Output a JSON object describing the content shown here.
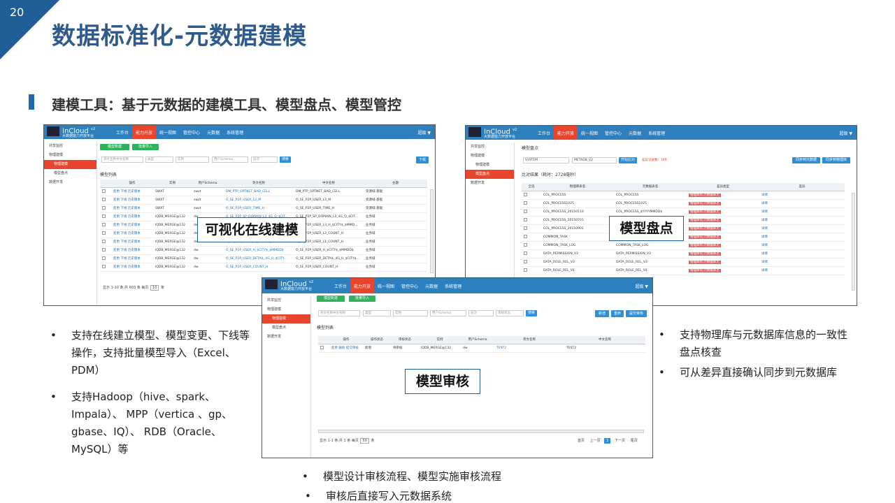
{
  "page_number": "20",
  "title": "数据标准化-元数据建模",
  "subtitle": "建模工具：基于元数据的建模工具、模型盘点、模型管控",
  "brand": {
    "name": "InCloud",
    "version": "v2",
    "tagline": "大数据能力开放平台",
    "accent": "#e8452c",
    "bar": "#2e7fbe"
  },
  "nav": [
    "工作台",
    "能力开放",
    "统一视图",
    "管控中心",
    "元数据",
    "系统管理"
  ],
  "nav_active": "能力开放",
  "user": "超级 ▼",
  "sidebar": [
    "共享监控",
    "物理建模",
    "物理建模",
    "模型盘点",
    "数据开发"
  ],
  "shot1": {
    "btn_new": "模型新建",
    "btn_import": "批量导入",
    "filters": [
      "英文名称中文名称",
      "类型",
      "实例",
      "用户Schema",
      "层次"
    ],
    "search": "搜索",
    "download": "下载",
    "list_title": "模型列表",
    "headers": [
      "",
      "操作",
      "实例",
      "用户Schema",
      "英文名称",
      "中文名称",
      "主题"
    ],
    "rows": [
      [
        "",
        "变更 下线 历史版本",
        "SWXT",
        "swxt",
        "DM_PTP_OPTNET_BAD_CELL",
        "DM_PTP_OPTNET_BAD_CELL",
        "资源域-基础"
      ],
      [
        "",
        "变更 下线 历史版本",
        "SWXT",
        "swxt",
        "O_SE_P2P_USER_L3_M",
        "O_SE_P2P_USER_L3_M",
        "资源域-基础"
      ],
      [
        "",
        "变更 下线 历史版本",
        "SWXT",
        "swxt",
        "O_SE_P2P_USER_TIME_H",
        "O_SE_P2P_USER_TIME_H",
        "资源域-基础"
      ],
      [
        "",
        "变更 下线 历史版本",
        "IQDB_MERGE@132",
        "dw",
        "O_SE_P2P_SP_DOMAIN_L3_4G_Q_$CIT...",
        "O_SE_P2P_SP_DOMAIN_L3_4G_Q_$CIT...",
        "业务域"
      ],
      [
        "",
        "变更 下线 历史版本",
        "IQDB_MERGE@132",
        "dw",
        "O_SE_P2P_USER_L3_H_$CITY$_$MMD...",
        "O_SE_P2P_USER_L3_H_$CITY$_$MMD...",
        "业务域"
      ],
      [
        "",
        "变更 下线 历史版本",
        "IQDB_MERGE@132",
        "dw",
        "O_SE_P2P_USER_L3_COUNT_H",
        "O_SE_P2P_USER_L3_COUNT_H",
        "业务域"
      ],
      [
        "",
        "变更 下线 历史版本",
        "IQDB_MERGE@132",
        "dw",
        "O_SE_P2P_USER_L1_COUNT_H",
        "O_SE_P2P_USER_L1_COUNT_H",
        "业务域"
      ],
      [
        "",
        "变更 下线 历史版本",
        "IQDB_MERGE@132",
        "dw",
        "O_SE_P2P_USER_H_$CITY$_$MMDD$",
        "O_SE_P2P_USER_H_$CITY$_$MMDD$",
        "业务域"
      ],
      [
        "",
        "变更 下线 历史版本",
        "IQDB_MERGE@132",
        "dw",
        "O_SE_P2P_USER_DETAIL_4G_H_$CITY...",
        "O_SE_P2P_USER_DETAIL_4G_H_$CITY$...",
        "业务域"
      ],
      [
        "",
        "变更 下线 历史版本",
        "IQDB_MERGE@132",
        "dw",
        "O_SE_P2P_USER_COUNT_H",
        "O_SE_P2P_USER_COUNT_H",
        "业务域"
      ]
    ],
    "pager": "显示 1-10 条,共 603 条 每页",
    "page_size": "10",
    "unit": "条",
    "label": "可视化在线建模"
  },
  "shot2": {
    "page_title": "模型盘点",
    "sel1": "SYSTEM",
    "sel2": "METADB_V2",
    "btn_start": "开始比对",
    "hint": "差异记录数：189",
    "btn_sync1": "同步到元数据",
    "btn_sync2": "同步到物理库",
    "result": "比对结果（耗时：2728毫秒）",
    "headers": [
      "全选",
      "物理库表名",
      "元数据表名",
      "差异类型",
      "差异"
    ],
    "rows": [
      [
        "COL_PROCESS",
        "COL_PROCESS",
        "物理库有,元数据库无",
        "详情"
      ],
      [
        "COL_PROCESS1025",
        "COL_PROCESS1025",
        "物理库有,元数据库无",
        "详情"
      ],
      [
        "COL_PROCESS_20150110",
        "COL_PROCESS_$YYYYMMDD$",
        "物理库有,元数据库无",
        "详情"
      ],
      [
        "COL_PROCESS_20150701",
        "COL_PROCESS_$YYYYMMDD$",
        "物理库有,元数据库无",
        "详情"
      ],
      [
        "COL_PROCESS_20150901",
        "COL_PROCESS_$YYYYMMDD$",
        "物理库有,元数据库无",
        "详情"
      ],
      [
        "COMMON_TASK",
        "COMMON_TASK",
        "物理库有,元数据库无",
        "详情"
      ],
      [
        "COMMON_TASK_LOG",
        "COMMON_TASK_LOG",
        "物理库有,元数据库无",
        "详情"
      ],
      [
        "DATA_PERMISSION_V3",
        "DATA_PERMISSION_V3",
        "物理库有,元数据库无",
        "详情"
      ],
      [
        "DATA_ROLE_REL_V3",
        "DATA_ROLE_REL_V3",
        "物理库有,元数据库无",
        "详情"
      ],
      [
        "DATA_ROLE_REL_V4",
        "DATA_ROLE_REL_V4",
        "物理库有,元数据库无",
        "详情"
      ]
    ],
    "label": "模型盘点"
  },
  "shot3": {
    "btn_new": "模型新建",
    "btn_import": "批量导入",
    "filters": [
      "英文名称中文名称",
      "类型",
      "实例",
      "用户Schema",
      "层次",
      "审核状态"
    ],
    "search": "搜索",
    "btn_a": "新增",
    "btn_b": "重命",
    "btn_c": "提交审核",
    "list_title": "模型列表",
    "headers": [
      "",
      "操作",
      "操作状态",
      "审核状态",
      "实例",
      "用户Schema",
      "英文名称",
      "中文名称"
    ],
    "row": [
      "",
      "变更 删除 提交审核",
      "新增",
      "待审核",
      "IQDB_MERGE@132",
      "dw",
      "TEST2",
      "TEST2"
    ],
    "pager": "显示 1-1 条,共 1 条 每页",
    "page_size": "50",
    "unit": "条",
    "pages": [
      "首页",
      "上一页",
      "1",
      "下一页",
      "尾页"
    ],
    "label": "模型审核"
  },
  "bullets_left": [
    "支持在线建立模型、模型变更、下线等操作，支持批量模型导入（Excel、PDM）",
    "支持Hadoop（hive、spark、Impala）、 MPP（vertica 、gp、gbase、IQ）、 RDB（Oracle、MySQL）等"
  ],
  "bullets_right": [
    "支持物理库与元数据库信息的一致性盘点核查",
    "可从差异直接确认同步到元数据库"
  ],
  "bullets_bottom": [
    "模型设计审核流程、模型实施审核流程",
    "审核后直接写入元数据系统"
  ],
  "bullet_char": "•"
}
